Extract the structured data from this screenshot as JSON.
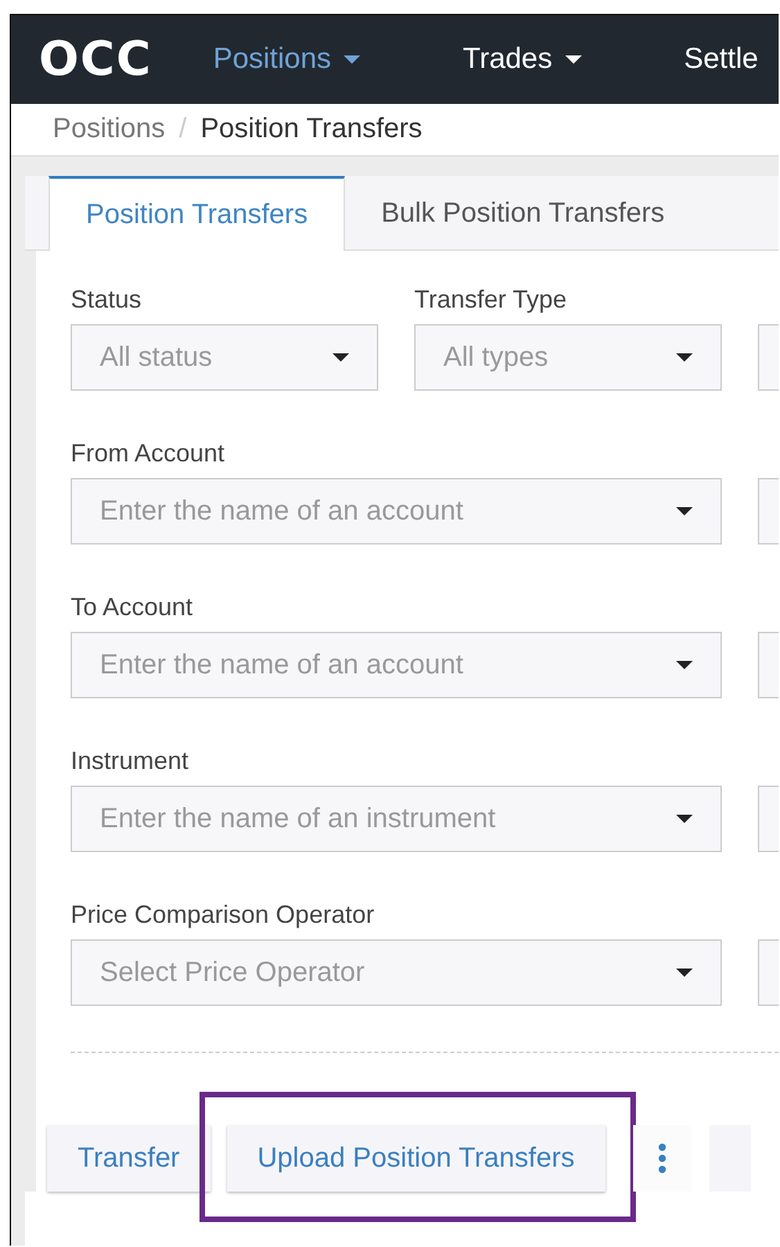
{
  "nav": {
    "logo": "OCC",
    "items": [
      {
        "label": "Positions",
        "selected": true,
        "has_menu": true
      },
      {
        "label": "Trades",
        "selected": false,
        "has_menu": true
      },
      {
        "label": "Settle",
        "selected": false,
        "has_menu": false
      }
    ]
  },
  "breadcrumb": {
    "items": [
      "Positions",
      "Position Transfers"
    ],
    "separator": "/"
  },
  "tabs": [
    {
      "label": "Position Transfers",
      "selected": true
    },
    {
      "label": "Bulk Position Transfers",
      "selected": false
    }
  ],
  "filters": [
    {
      "fields": [
        {
          "label": "Status",
          "placeholder": "All status"
        },
        {
          "label": "Transfer Type",
          "placeholder": "All types"
        }
      ]
    },
    {
      "fields": [
        {
          "label": "From Account",
          "placeholder": "Enter the name of an account"
        }
      ]
    },
    {
      "fields": [
        {
          "label": "To Account",
          "placeholder": "Enter the name of an account"
        }
      ]
    },
    {
      "fields": [
        {
          "label": "Instrument",
          "placeholder": "Enter the name of an instrument"
        }
      ]
    },
    {
      "fields": [
        {
          "label": "Price Comparison Operator",
          "placeholder": "Select Price Operator"
        }
      ]
    }
  ],
  "actions": [
    {
      "kind": "button",
      "label": "Transfer",
      "highlighted": false
    },
    {
      "kind": "button",
      "label": "Upload Position Transfers",
      "highlighted": true
    },
    {
      "kind": "more",
      "highlighted": false
    }
  ]
}
